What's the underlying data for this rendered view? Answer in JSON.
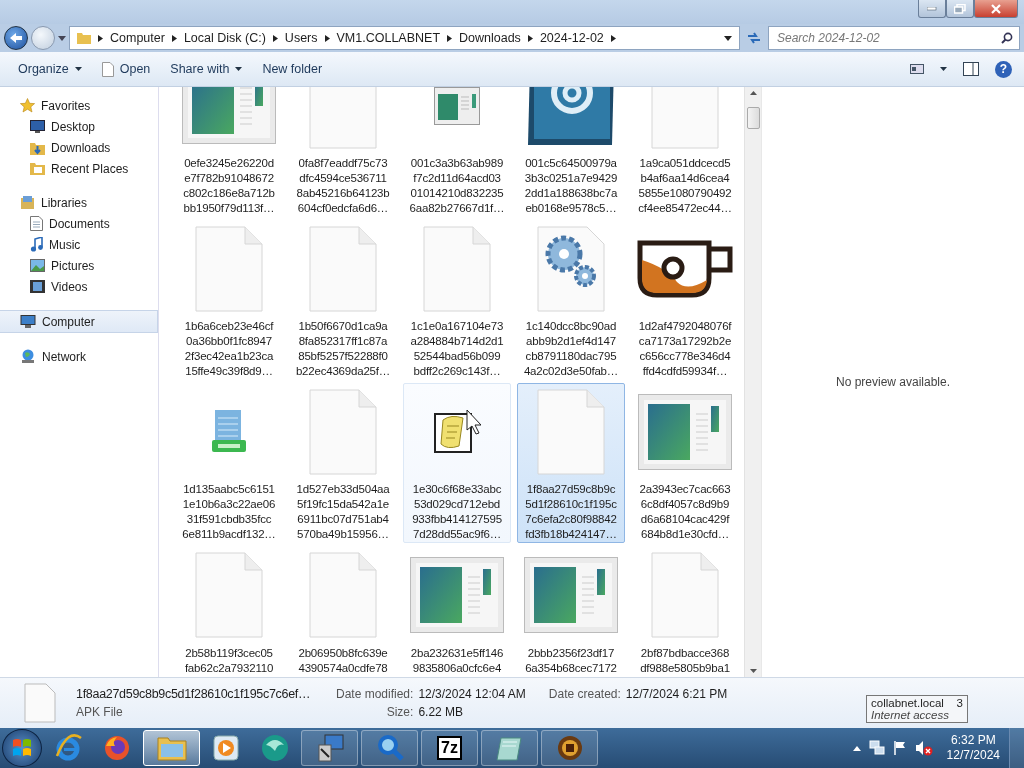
{
  "address": {
    "crumbs": [
      "Computer",
      "Local Disk (C:)",
      "Users",
      "VM1.COLLABNET",
      "Downloads",
      "2024-12-02"
    ],
    "search_placeholder": "Search 2024-12-02"
  },
  "toolbar": {
    "buttons": [
      {
        "label": "Organize",
        "kind": "menu"
      },
      {
        "label": "Open",
        "kind": "open"
      },
      {
        "label": "Share with",
        "kind": "menu"
      },
      {
        "label": "New folder",
        "kind": "plain"
      }
    ],
    "help": "?"
  },
  "sidebar": {
    "groups": [
      {
        "label": "Favorites",
        "kind": "star",
        "selected": false,
        "children": [
          {
            "label": "Desktop",
            "kind": "desktop",
            "selected": false
          },
          {
            "label": "Downloads",
            "kind": "downloads",
            "selected": false
          },
          {
            "label": "Recent Places",
            "kind": "recent",
            "selected": false
          }
        ]
      },
      {
        "label": "Libraries",
        "kind": "library",
        "selected": false,
        "children": [
          {
            "label": "Documents",
            "kind": "documents",
            "selected": false
          },
          {
            "label": "Music",
            "kind": "music",
            "selected": false
          },
          {
            "label": "Pictures",
            "kind": "pictures",
            "selected": false
          },
          {
            "label": "Videos",
            "kind": "videos",
            "selected": false
          }
        ]
      },
      {
        "label": "Computer",
        "kind": "computer",
        "selected": true
      },
      {
        "label": "Network",
        "kind": "network",
        "selected": false
      }
    ]
  },
  "files": [
    {
      "lines": [
        "0efe3245e26220d",
        "e7f782b91048672",
        "c802c186e8a712b",
        "bb1950f79d113f…"
      ],
      "kind": "viewer",
      "selected": false,
      "hovered": false
    },
    {
      "lines": [
        "0fa8f7eaddf75c73",
        "dfc4594ce536711",
        "8ab45216b64123b",
        "604cf0edcfa6d6…"
      ],
      "kind": "blank",
      "selected": false,
      "hovered": false
    },
    {
      "lines": [
        "001c3a3b63ab989",
        "f7c2d11d64acd03",
        "01014210d832235",
        "6aa82b27667d1f…"
      ],
      "kind": "small-window",
      "selected": false,
      "hovered": false
    },
    {
      "lines": [
        "001c5c64500979a",
        "3b3c0251a7e9429",
        "2dd1a188638bc7a",
        "eb0168e9578c5…"
      ],
      "kind": "email",
      "selected": false,
      "hovered": false
    },
    {
      "lines": [
        "1a9ca051ddcecd5",
        "b4af6aa14d6cea4",
        "5855e1080790492",
        "cf4ee85472ec44…"
      ],
      "kind": "blank",
      "selected": false,
      "hovered": false
    },
    {
      "lines": [
        "1b6a6ceb23e46cf",
        "0a36bb0f1fc8947",
        "2f3ec42ea1b23ca",
        "15ffe49c39f8d9…"
      ],
      "kind": "blank",
      "selected": false,
      "hovered": false
    },
    {
      "lines": [
        "1b50f6670d1ca9a",
        "8fa852317ff1c87a",
        "85bf5257f52288f0",
        "b22ec4369da25f…"
      ],
      "kind": "blank",
      "selected": false,
      "hovered": false
    },
    {
      "lines": [
        "1c1e0a167104e73",
        "a284884b714d2d1",
        "52544bad56b099",
        "bdff2c269c143f…"
      ],
      "kind": "blank",
      "selected": false,
      "hovered": false
    },
    {
      "lines": [
        "1c140dcc8bc90ad",
        "abb9b2d1ef4d147",
        "cb8791180dac795",
        "4a2c02d3e50fab…"
      ],
      "kind": "gears",
      "selected": false,
      "hovered": false
    },
    {
      "lines": [
        "1d2af4792048076f",
        "ca7173a17292b2e",
        "c656cc778e346d4",
        "ffd4cdfd59934f…"
      ],
      "kind": "cup",
      "selected": false,
      "hovered": false
    },
    {
      "lines": [
        "1d135aabc5c6151",
        "1e10b6a3c22ae06",
        "31f591cbdb35fcc",
        "6e811b9acdf132…"
      ],
      "kind": "xlsx",
      "selected": false,
      "hovered": false
    },
    {
      "lines": [
        "1d527eb33d504aa",
        "5f19fc15da542a1e",
        "6911bc07d751ab4",
        "570ba49b15956…"
      ],
      "kind": "blank",
      "selected": false,
      "hovered": false
    },
    {
      "lines": [
        "1e30c6f68e33abc",
        "53d029cd712ebd",
        "933fbb414127595",
        "7d28dd55ac9f6…"
      ],
      "kind": "script",
      "selected": false,
      "hovered": true
    },
    {
      "lines": [
        "1f8aa27d59c8b9c",
        "5d1f28610c1f195c",
        "7c6efa2c80f98842",
        "fd3fb18b424147…"
      ],
      "kind": "blank",
      "selected": true,
      "hovered": false
    },
    {
      "lines": [
        "2a3943ec7cac663",
        "6c8df4057c8d9b9",
        "d6a68104cac429f",
        "684b8d1e30cfd…"
      ],
      "kind": "viewer",
      "selected": false,
      "hovered": false
    },
    {
      "lines": [
        "2b58b119f3cec05",
        "fab62c2a7932110"
      ],
      "kind": "blank",
      "selected": false,
      "hovered": false
    },
    {
      "lines": [
        "2b06950b8fc639e",
        "4390574a0cdfe78"
      ],
      "kind": "blank",
      "selected": false,
      "hovered": false
    },
    {
      "lines": [
        "2ba232631e5ff146",
        "9835806a0cfc6e4"
      ],
      "kind": "viewer",
      "selected": false,
      "hovered": false
    },
    {
      "lines": [
        "2bbb2356f23df17",
        "6a354b68cec7172"
      ],
      "kind": "viewer",
      "selected": false,
      "hovered": false
    },
    {
      "lines": [
        "2bf87bdbacce368",
        "df988e5805b9ba1"
      ],
      "kind": "blank",
      "selected": false,
      "hovered": false
    }
  ],
  "preview": {
    "message": "No preview available."
  },
  "details": {
    "name": "1f8aa27d59c8b9c5d1f28610c1f195c7c6ef…",
    "type": "APK File",
    "fields": [
      {
        "label": "Date modified:",
        "value": "12/3/2024 12:04 AM"
      },
      {
        "label": "Size:",
        "value": "6.22 MB"
      },
      {
        "label": "Date created:",
        "value": "12/7/2024 6:21 PM"
      }
    ]
  },
  "taskbar": {
    "apps": [
      {
        "kind": "ie",
        "active": false
      },
      {
        "kind": "firefox",
        "active": false
      },
      {
        "kind": "explorer",
        "active": true
      },
      {
        "kind": "media",
        "active": false
      },
      {
        "kind": "globe",
        "active": false
      },
      {
        "kind": "network-setup",
        "active": false
      },
      {
        "kind": "magnifier",
        "active": false
      },
      {
        "kind": "sevenzip",
        "label": "7z",
        "active": false
      },
      {
        "kind": "notepad",
        "active": false
      },
      {
        "kind": "game",
        "active": false
      }
    ],
    "tooltip": {
      "title": "collabnet.local",
      "count": "3",
      "subtitle": "Internet access"
    },
    "time": "6:32 PM",
    "date": "12/7/2024"
  }
}
